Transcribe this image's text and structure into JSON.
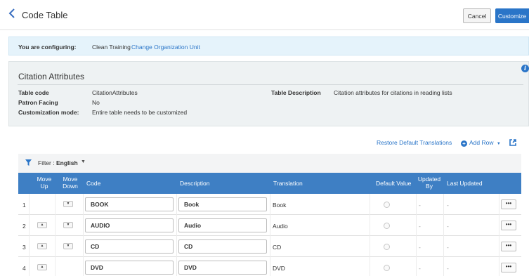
{
  "header": {
    "title": "Code Table",
    "cancel_label": "Cancel",
    "customize_label": "Customize"
  },
  "config": {
    "label": "You are configuring:",
    "value": "Clean Training",
    "link": "Change Organization Unit"
  },
  "attributes": {
    "title": "Citation Attributes",
    "table_code_label": "Table code",
    "table_code_value": "CitationAttributes",
    "patron_facing_label": "Patron Facing",
    "patron_facing_value": "No",
    "customization_mode_label": "Customization mode:",
    "customization_mode_value": "Entire table needs to be customized",
    "table_description_label": "Table Description",
    "table_description_value": "Citation attributes for citations in reading lists"
  },
  "actions": {
    "restore_label": "Restore Default Translations",
    "add_row_label": "Add Row"
  },
  "filter": {
    "label": "Filter :",
    "value": "English"
  },
  "table": {
    "columns": {
      "move_up": "Move Up",
      "move_down": "Move Down",
      "code": "Code",
      "description": "Description",
      "translation": "Translation",
      "default_value": "Default Value",
      "updated_by": "Updated By",
      "last_updated": "Last Updated"
    },
    "rows": [
      {
        "num": "1",
        "code": "BOOK",
        "description": "Book",
        "translation": "Book",
        "updated_by": "-",
        "last_updated": "-",
        "has_up": false,
        "has_down": true
      },
      {
        "num": "2",
        "code": "AUDIO",
        "description": "Audio",
        "translation": "Audio",
        "updated_by": "-",
        "last_updated": "-",
        "has_up": true,
        "has_down": true
      },
      {
        "num": "3",
        "code": "CD",
        "description": "CD",
        "translation": "CD",
        "updated_by": "-",
        "last_updated": "-",
        "has_up": true,
        "has_down": true
      },
      {
        "num": "4",
        "code": "DVD",
        "description": "DVD",
        "translation": "DVD",
        "updated_by": "-",
        "last_updated": "-",
        "has_up": true,
        "has_down": false
      }
    ],
    "more_label": "•••"
  },
  "colors": {
    "accent": "#2a75c8",
    "header_bg": "#3e7fc4",
    "config_bg": "#e5f3fb",
    "panel_bg": "#eef2f3"
  },
  "icons": {
    "back": "chevron-left-icon",
    "info": "info-icon",
    "add": "plus-circle-icon",
    "popout": "external-link-icon",
    "filter": "funnel-icon"
  }
}
